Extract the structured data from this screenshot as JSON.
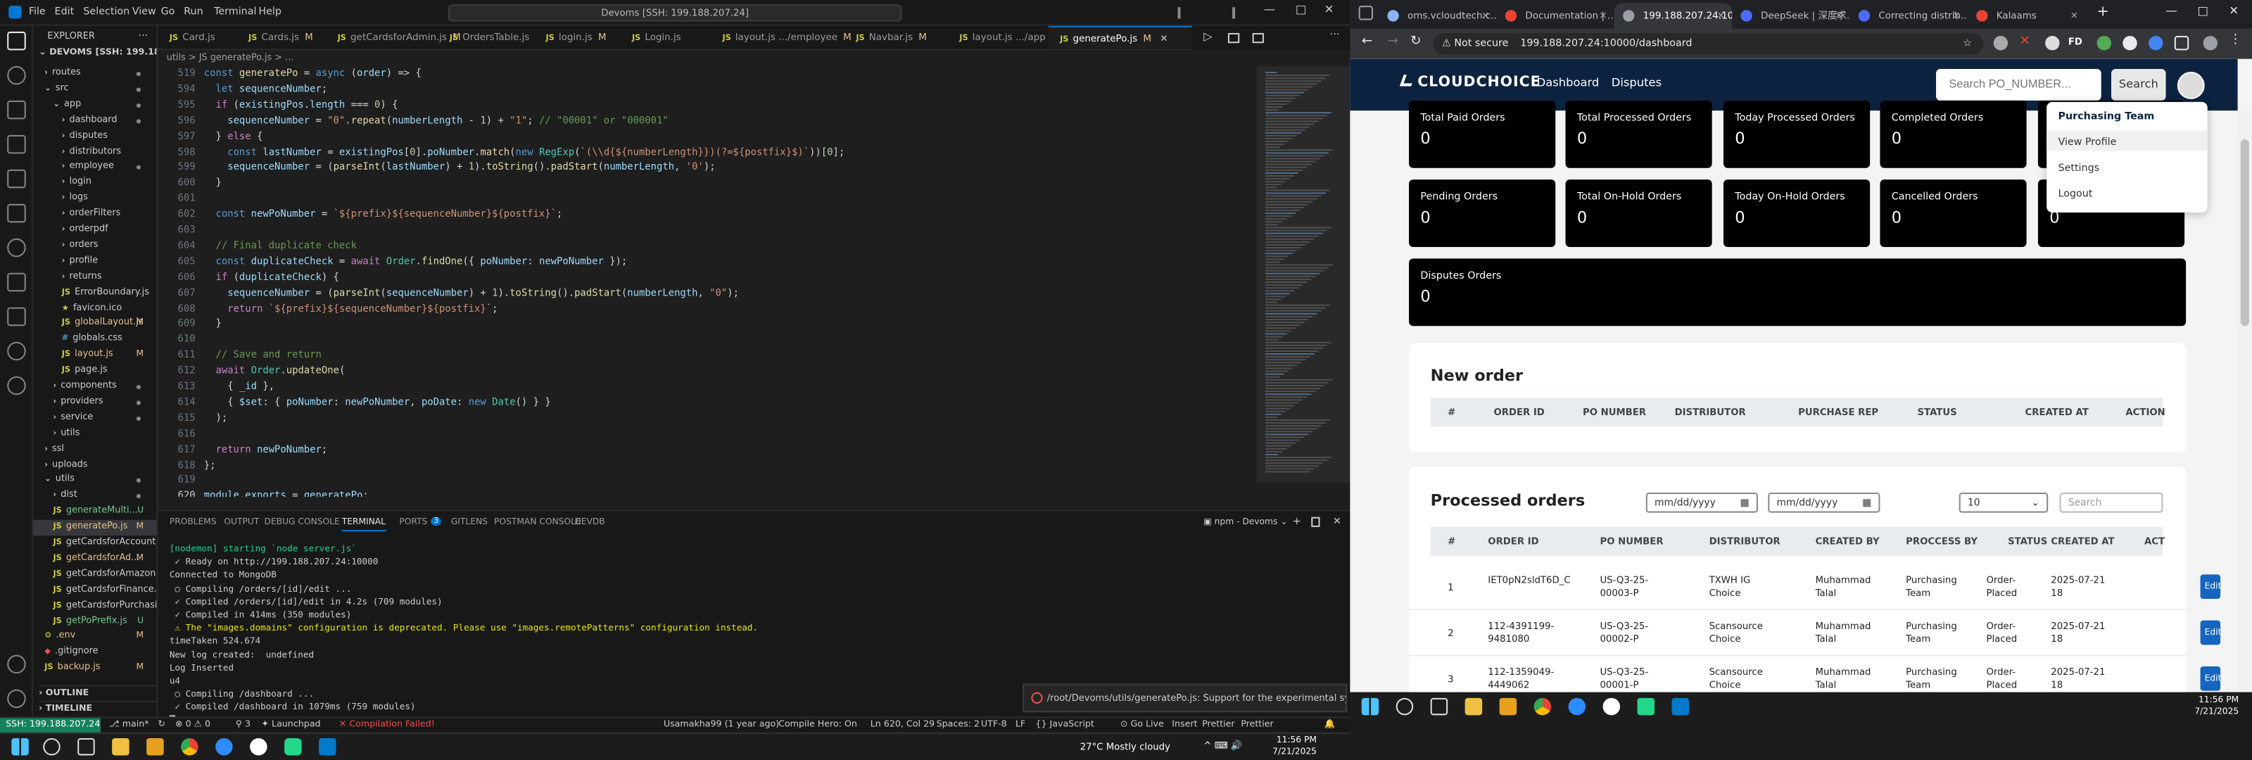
{
  "vscode": {
    "menus": [
      "File",
      "Edit",
      "Selection",
      "View",
      "Go",
      "Run",
      "Terminal",
      "Help"
    ],
    "command_center": "Devoms [SSH: 199.188.207.24]",
    "explorer_title": "EXPLORER",
    "workspace": "DEVOMS [SSH: 199.188.20...",
    "tree": [
      {
        "label": "routes",
        "indent": 1,
        "type": "folder",
        "dot": true
      },
      {
        "label": "src",
        "indent": 1,
        "type": "folder-open",
        "dot": true
      },
      {
        "label": "app",
        "indent": 2,
        "type": "folder-open",
        "dot": true
      },
      {
        "label": "dashboard",
        "indent": 3,
        "type": "folder",
        "dot": true
      },
      {
        "label": "disputes",
        "indent": 3,
        "type": "folder"
      },
      {
        "label": "distributors",
        "indent": 3,
        "type": "folder"
      },
      {
        "label": "employee",
        "indent": 3,
        "type": "folder",
        "dot": true
      },
      {
        "label": "login",
        "indent": 3,
        "type": "folder"
      },
      {
        "label": "logs",
        "indent": 3,
        "type": "folder"
      },
      {
        "label": "orderFilters",
        "indent": 3,
        "type": "folder"
      },
      {
        "label": "orderpdf",
        "indent": 3,
        "type": "folder"
      },
      {
        "label": "orders",
        "indent": 3,
        "type": "folder"
      },
      {
        "label": "profile",
        "indent": 3,
        "type": "folder"
      },
      {
        "label": "returns",
        "indent": 3,
        "type": "folder"
      },
      {
        "label": "ErrorBoundary.js",
        "indent": 3,
        "type": "js"
      },
      {
        "label": "favicon.ico",
        "indent": 3,
        "type": "ico"
      },
      {
        "label": "globalLayout.js",
        "indent": 3,
        "type": "js",
        "mark": "M"
      },
      {
        "label": "globals.css",
        "indent": 3,
        "type": "css"
      },
      {
        "label": "layout.js",
        "indent": 3,
        "type": "js",
        "mark": "M"
      },
      {
        "label": "page.js",
        "indent": 3,
        "type": "js"
      },
      {
        "label": "components",
        "indent": 2,
        "type": "folder",
        "dot": true
      },
      {
        "label": "providers",
        "indent": 2,
        "type": "folder",
        "dot": true
      },
      {
        "label": "service",
        "indent": 2,
        "type": "folder",
        "dot": true
      },
      {
        "label": "utils",
        "indent": 2,
        "type": "folder"
      },
      {
        "label": "ssl",
        "indent": 1,
        "type": "folder"
      },
      {
        "label": "uploads",
        "indent": 1,
        "type": "folder"
      },
      {
        "label": "utils",
        "indent": 1,
        "type": "folder-open",
        "dot": true
      },
      {
        "label": "dist",
        "indent": 2,
        "type": "folder",
        "dot": true
      },
      {
        "label": "generateMulti...",
        "indent": 2,
        "type": "js",
        "mark": "U"
      },
      {
        "label": "generatePo.js",
        "indent": 2,
        "type": "js",
        "mark": "M",
        "selected": true
      },
      {
        "label": "getCardsforAccount.js",
        "indent": 2,
        "type": "js"
      },
      {
        "label": "getCardsforAd...",
        "indent": 2,
        "type": "js",
        "mark": "M"
      },
      {
        "label": "getCardsforAmazon.js",
        "indent": 2,
        "type": "js"
      },
      {
        "label": "getCardsforFinance.js",
        "indent": 2,
        "type": "js"
      },
      {
        "label": "getCardsforPurchasi...",
        "indent": 2,
        "type": "js"
      },
      {
        "label": "getPoPrefix.js",
        "indent": 2,
        "type": "js",
        "mark": "U"
      },
      {
        "label": ".env",
        "indent": 1,
        "type": "env",
        "mark": "M"
      },
      {
        "label": ".gitignore",
        "indent": 1,
        "type": "git"
      },
      {
        "label": "backup.js",
        "indent": 1,
        "type": "js",
        "mark": "M"
      }
    ],
    "outline": "OUTLINE",
    "timeline": "TIMELINE",
    "tabs": [
      {
        "label": "Card.js",
        "mark": ""
      },
      {
        "label": "Cards.js",
        "mark": "M"
      },
      {
        "label": "getCardsforAdmin.js",
        "mark": "M"
      },
      {
        "label": "OrdersTable.js",
        "mark": ""
      },
      {
        "label": "login.js",
        "mark": "M"
      },
      {
        "label": "Login.js",
        "mark": ""
      },
      {
        "label": "layout.js .../employee",
        "mark": "M"
      },
      {
        "label": "Navbar.js",
        "mark": "M"
      },
      {
        "label": "layout.js .../app",
        "mark": "M"
      },
      {
        "label": "generatePo.js",
        "mark": "M",
        "active": true
      }
    ],
    "breadcrumb": "utils > JS generatePo.js > ...",
    "code": [
      {
        "n": "519",
        "html": "<span class='kw'>const</span> <span class='fn'>generatePo</span> = <span class='kw'>async</span> (<span class='vr'>order</span>) => {"
      },
      {
        "n": "594",
        "html": "  <span class='kw'>let</span> <span class='vr'>sequenceNumber</span>;"
      },
      {
        "n": "595",
        "html": "  <span class='kc'>if</span> (<span class='vr'>existingPos</span>.<span class='vr'>length</span> === <span class='nu'>0</span>) {"
      },
      {
        "n": "596",
        "html": "    <span class='vr'>sequenceNumber</span> = <span class='st'>\"0\"</span>.<span class='fn'>repeat</span>(<span class='vr'>numberLength</span> - <span class='nu'>1</span>) + <span class='st'>\"1\"</span>; <span class='cm'>// \"00001\" or \"000001\"</span>"
      },
      {
        "n": "597",
        "html": "  } <span class='kc'>else</span> {"
      },
      {
        "n": "598",
        "html": "    <span class='kw'>const</span> <span class='vr'>lastNumber</span> = <span class='vr'>existingPos</span>[<span class='nu'>0</span>].<span class='vr'>poNumber</span>.<span class='fn'>match</span>(<span class='kw'>new</span> <span class='ty'>RegExp</span>(<span class='st'>`(\\\\d{${numberLength}})(?=${postfix}$)`</span>))[<span class='nu'>0</span>];"
      },
      {
        "n": "599",
        "html": "    <span class='vr'>sequenceNumber</span> = (<span class='fn'>parseInt</span>(<span class='vr'>lastNumber</span>) + <span class='nu'>1</span>).<span class='fn'>toString</span>().<span class='fn'>padStart</span>(<span class='vr'>numberLength</span>, <span class='st'>'0'</span>);"
      },
      {
        "n": "600",
        "html": "  }"
      },
      {
        "n": "601",
        "html": ""
      },
      {
        "n": "602",
        "html": "  <span class='kw'>const</span> <span class='vr'>newPoNumber</span> = <span class='st'>`${prefix}${sequenceNumber}${postfix}`</span>;"
      },
      {
        "n": "603",
        "html": ""
      },
      {
        "n": "604",
        "html": "  <span class='cm'>// Final duplicate check</span>"
      },
      {
        "n": "605",
        "html": "  <span class='kw'>const</span> <span class='vr'>duplicateCheck</span> = <span class='kc'>await</span> <span class='ty'>Order</span>.<span class='fn'>findOne</span>({ <span class='vr'>poNumber</span>: <span class='vr'>newPoNumber</span> });"
      },
      {
        "n": "606",
        "html": "  <span class='kc'>if</span> (<span class='vr'>duplicateCheck</span>) {"
      },
      {
        "n": "607",
        "html": "    <span class='vr'>sequenceNumber</span> = (<span class='fn'>parseInt</span>(<span class='vr'>sequenceNumber</span>) + <span class='nu'>1</span>).<span class='fn'>toString</span>().<span class='fn'>padStart</span>(<span class='vr'>numberLength</span>, <span class='st'>\"0\"</span>);"
      },
      {
        "n": "608",
        "html": "    <span class='kc'>return</span> <span class='st'>`${prefix}${sequenceNumber}${postfix}`</span>;"
      },
      {
        "n": "609",
        "html": "  }"
      },
      {
        "n": "610",
        "html": ""
      },
      {
        "n": "611",
        "html": "  <span class='cm'>// Save and return</span>"
      },
      {
        "n": "612",
        "html": "  <span class='kc'>await</span> <span class='ty'>Order</span>.<span class='fn'>updateOne</span>("
      },
      {
        "n": "613",
        "html": "    { <span class='vr'>_id</span> },"
      },
      {
        "n": "614",
        "html": "    { <span class='vr'>$set</span>: { <span class='vr'>poNumber</span>: <span class='vr'>newPoNumber</span>, <span class='vr'>poDate</span>: <span class='kw'>new</span> <span class='ty'>Date</span>() } }"
      },
      {
        "n": "615",
        "html": "  );"
      },
      {
        "n": "616",
        "html": ""
      },
      {
        "n": "617",
        "html": "  <span class='kc'>return</span> <span class='vr'>newPoNumber</span>;"
      },
      {
        "n": "618",
        "html": "};"
      },
      {
        "n": "619",
        "html": ""
      },
      {
        "n": "620",
        "html": "<span class='vr'>module</span>.<span class='vr'>exports</span> = <span class='vr'>generatePo</span>;",
        "cur": true
      }
    ],
    "panel_tabs": [
      "PROBLEMS",
      "OUTPUT",
      "DEBUG CONSOLE",
      "TERMINAL",
      "PORTS",
      "GITLENS",
      "POSTMAN CONSOLE",
      "DEVDB"
    ],
    "ports_badge": "3",
    "terminal_name": "npm - Devoms",
    "terminal": [
      {
        "t": "[nodemon] starting `node server.js`",
        "c": "#23d18b"
      },
      {
        "t": " ✓ Ready on http://199.188.207.24:10000",
        "c": "#cccccc"
      },
      {
        "t": "Connected to MongoDB",
        "c": "#cccccc"
      },
      {
        "t": " ○ Compiling /orders/[id]/edit ...",
        "c": "#cccccc"
      },
      {
        "t": " ✓ Compiled /orders/[id]/edit in 4.2s (709 modules)",
        "c": "#cccccc"
      },
      {
        "t": " ✓ Compiled in 414ms (350 modules)",
        "c": "#cccccc"
      },
      {
        "t": " ⚠ The \"images.domains\" configuration is deprecated. Please use \"images.remotePatterns\" configuration instead.",
        "c": "#e5e510"
      },
      {
        "t": "timeTaken 524.674",
        "c": "#cccccc"
      },
      {
        "t": "New log created:  undefined",
        "c": "#cccccc"
      },
      {
        "t": "Log Inserted",
        "c": "#cccccc"
      },
      {
        "t": "u4",
        "c": "#cccccc"
      },
      {
        "t": " ○ Compiling /dashboard ...",
        "c": "#cccccc"
      },
      {
        "t": " ✓ Compiled /dashboard in 1079ms (759 modules)",
        "c": "#cccccc"
      }
    ],
    "toast": "/root/Devoms/utils/generatePo.js: Support for the experimental syntax...",
    "status": {
      "remote": "SSH: 199.188.207.24",
      "branch": "main*",
      "sync": "↻",
      "errors": "⊗ 0 ⚠ 0",
      "ports": "3",
      "launchpad": "Launchpad",
      "compile": "Compilation Failed!",
      "blame": "Usamakha99 (1 year ago)",
      "hero": "Compile Hero: On",
      "pos": "Ln 620, Col 29",
      "spaces": "Spaces: 2",
      "enc": "UTF-8",
      "eol": "LF",
      "lang": "{} JavaScript",
      "golive": "Go Live",
      "insert": "Insert",
      "prettier1": "Prettier",
      "prettier2": "Prettier"
    }
  },
  "taskbar_left": {
    "weather": "27°C  Mostly cloudy",
    "time": "11:56 PM",
    "date": "7/21/2025"
  },
  "taskbar_right": {
    "time": "11:56 PM",
    "date": "7/21/2025"
  },
  "chrome": {
    "tabs": [
      {
        "label": "oms.vcloudtech.c...",
        "color": "#8ab4f8"
      },
      {
        "label": "Documentation | ...",
        "color": "#ea4335"
      },
      {
        "label": "199.188.207.24:10...",
        "color": "#9aa0a6",
        "active": true
      },
      {
        "label": "DeepSeek | 深度求...",
        "color": "#4d6bfe"
      },
      {
        "label": "Correcting distrib...",
        "color": "#4d6bfe"
      },
      {
        "label": "Kalaams",
        "color": "#ea4335"
      }
    ],
    "not_secure": "Not secure",
    "url": "199.188.207.24:10000/dashboard"
  },
  "app": {
    "logo": "CLOUDCHOICE",
    "nav": [
      "Dashboard",
      "Disputes"
    ],
    "search_placeholder": "Search PO_NUMBER...",
    "search_button": "Search",
    "dropdown": {
      "header": "Purchasing Team",
      "items": [
        "View Profile",
        "Settings",
        "Logout"
      ]
    },
    "cards": [
      {
        "label": "Total Paid Orders",
        "value": "0"
      },
      {
        "label": "Total Processed Orders",
        "value": "0"
      },
      {
        "label": "Today Processed Orders",
        "value": "0"
      },
      {
        "label": "Completed Orders",
        "value": "0"
      },
      {
        "label": "",
        "value": "0"
      },
      {
        "label": "Pending Orders",
        "value": "0"
      },
      {
        "label": "Total On-Hold Orders",
        "value": "0"
      },
      {
        "label": "Today On-Hold Orders",
        "value": "0"
      },
      {
        "label": "Cancelled Orders",
        "value": "0"
      },
      {
        "label": "",
        "value": "0"
      },
      {
        "label": "Disputes Orders",
        "value": "0"
      }
    ],
    "new_order": {
      "title": "New order",
      "columns": [
        "#",
        "ORDER ID",
        "PO NUMBER",
        "DISTRIBUTOR",
        "PURCHASE REP",
        "STATUS",
        "CREATED AT",
        "ACTION"
      ]
    },
    "processed": {
      "title": "Processed orders",
      "date_placeholder": "mm/dd/yyyy",
      "page_size": "10",
      "search_placeholder": "Search",
      "columns": [
        "#",
        "ORDER ID",
        "PO NUMBER",
        "DISTRIBUTOR",
        "CREATED BY",
        "PROCCESS BY",
        "STATUS",
        "CREATED AT",
        "ACT"
      ],
      "rows": [
        {
          "n": "1",
          "order_id": "IET0pN2sldT6D_C",
          "po": "US-Q3-25-\n00003-P",
          "dist": "TXWH IG\nChoice",
          "created_by": "Muhammad\nTalal",
          "proc": "Purchasing\nTeam",
          "status": "Order-\nPlaced",
          "created_at": "2025-07-21\n18",
          "action": "Edit"
        },
        {
          "n": "2",
          "order_id": "112-4391199-\n9481080",
          "po": "US-Q3-25-\n00002-P",
          "dist": "Scansource\nChoice",
          "created_by": "Muhammad\nTalal",
          "proc": "Purchasing\nTeam",
          "status": "Order-\nPlaced",
          "created_at": "2025-07-21\n18",
          "action": "Edit"
        },
        {
          "n": "3",
          "order_id": "112-1359049-\n4449062",
          "po": "US-Q3-25-\n00001-P",
          "dist": "Scansource\nChoice",
          "created_by": "Muhammad\nTalal",
          "proc": "Purchasing\nTeam",
          "status": "Order-\nPlaced",
          "created_at": "2025-07-21\n18",
          "action": "Edit"
        }
      ]
    }
  }
}
